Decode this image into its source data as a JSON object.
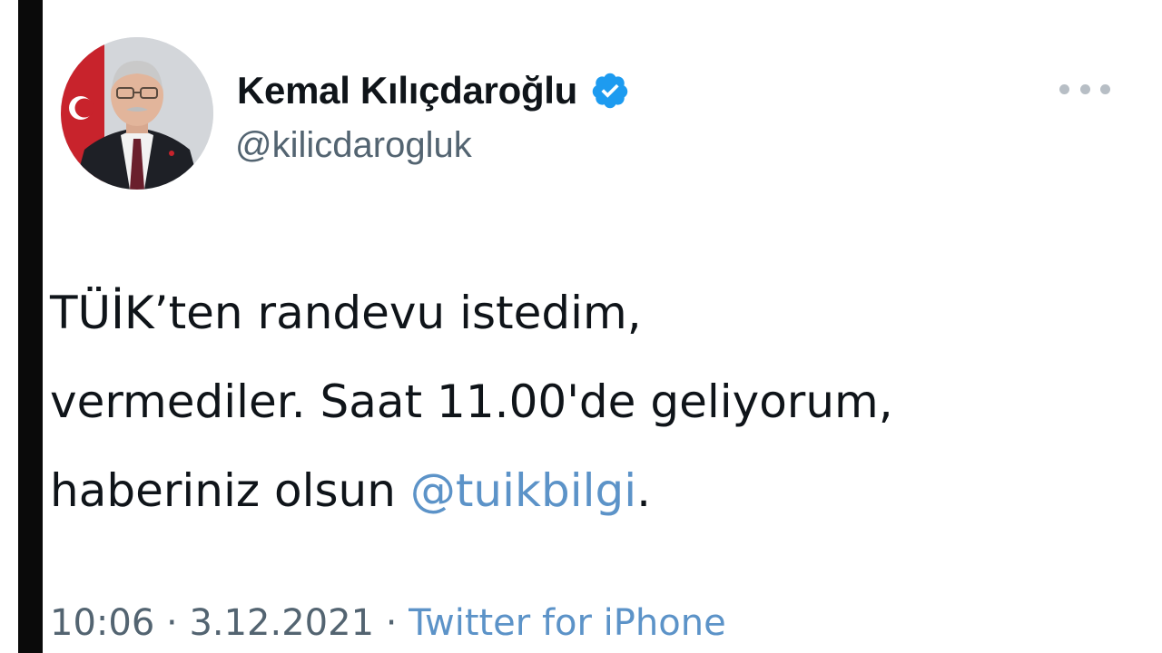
{
  "user": {
    "display_name": "Kemal Kılıçdaroğlu",
    "handle": "@kilicdarogluk",
    "verified": true,
    "verified_color": "#1d9bf0",
    "avatar_icon": "profile-photo"
  },
  "more_icon": "more-horizontal-icon",
  "tweet": {
    "line1": "TÜİK’ten randevu istedim,",
    "line2": "vermediler. Saat 11.00'de geliyorum,",
    "line3_prefix": "haberiniz olsun ",
    "mention": "@tuikbilgi",
    "line3_suffix": "."
  },
  "meta": {
    "time": "10:06",
    "separator1": " · ",
    "date": "3.12.2021",
    "separator2": " · ",
    "source": "Twitter for iPhone"
  },
  "colors": {
    "text": "#0f1419",
    "secondary": "#536471",
    "link": "#5c93c8"
  }
}
